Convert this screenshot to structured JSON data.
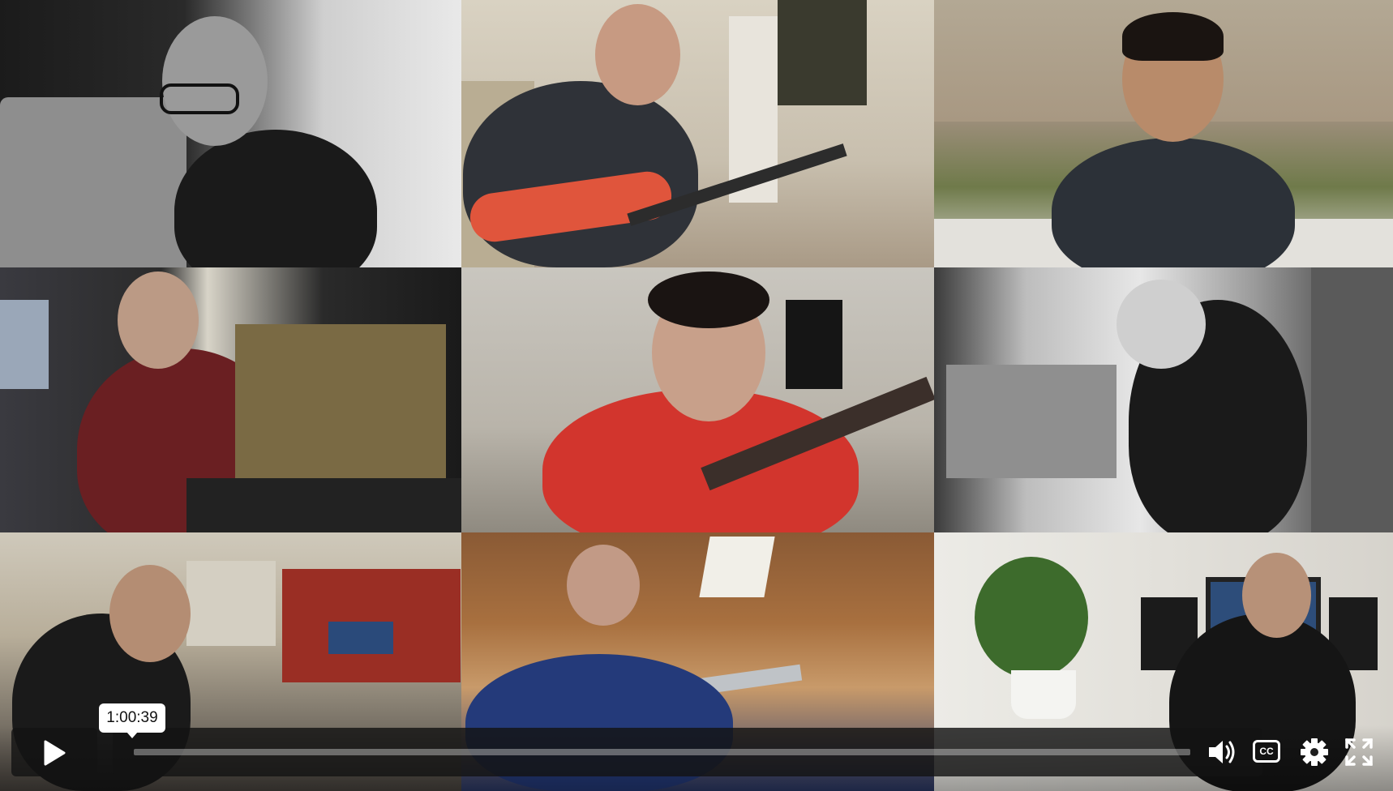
{
  "player": {
    "hover_time": "1:00:39",
    "progress_fraction": 0.0
  },
  "icons": {
    "play": "play-icon",
    "volume": "volume-icon",
    "captions": "captions-icon",
    "settings": "gear-icon",
    "fullscreen": "fullscreen-icon"
  },
  "captions_label": "CC"
}
